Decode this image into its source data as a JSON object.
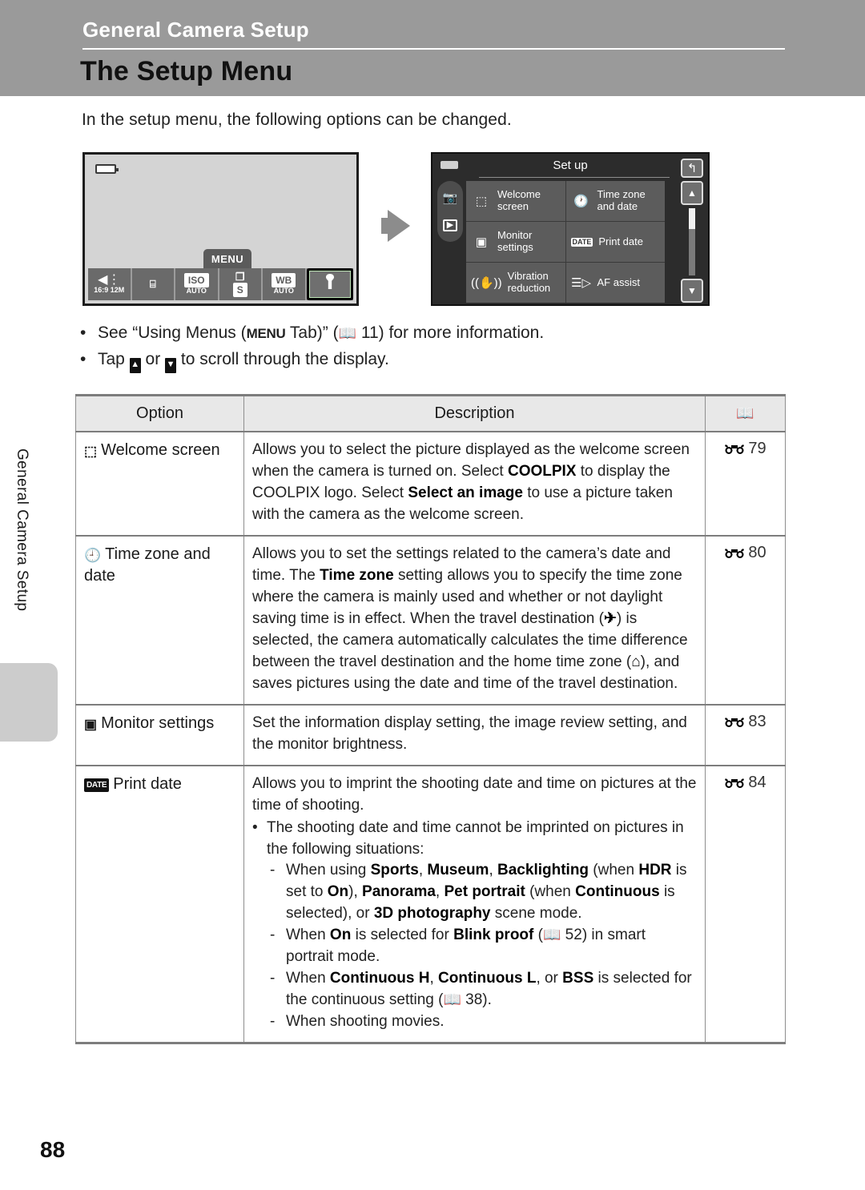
{
  "header": {
    "chapter": "General Camera Setup",
    "title": "The Setup Menu"
  },
  "intro": "In the setup menu, the following options can be changed.",
  "figure": {
    "camera_screen": {
      "menu_tab_label": "MENU",
      "battery_icon": "battery-icon",
      "menu_bar": [
        {
          "icon": "flash-icon",
          "top": "❮∷",
          "bottom": "16:9 12M",
          "selected": false
        },
        {
          "icon": "touch-shutter-icon",
          "top": "☐",
          "bottom": "",
          "selected": false
        },
        {
          "icon": "iso-icon",
          "top": "ISO",
          "bottom": "AUTO",
          "selected": false
        },
        {
          "icon": "continuous-icon",
          "top": "❐",
          "bottom": "S",
          "selected": false
        },
        {
          "icon": "white-balance-icon",
          "top": "WB",
          "bottom": "AUTO",
          "selected": false
        },
        {
          "icon": "wrench-setup-icon",
          "top": "⑀",
          "bottom": "",
          "selected": true
        }
      ]
    },
    "arrow_icon": "right-arrow-icon",
    "setup_screen": {
      "title": "Set up",
      "back_icon": "back-arrow-icon",
      "side_tabs": [
        "shooting-mode-icon",
        "playback-mode-icon"
      ],
      "scroll_up_icon": "triangle-up-icon",
      "scroll_down_icon": "triangle-down-icon",
      "items": [
        {
          "icon": "welcome-screen-icon",
          "label": "Welcome\nscreen"
        },
        {
          "icon": "clock-icon",
          "label": "Time zone\nand date"
        },
        {
          "icon": "monitor-icon",
          "label": "Monitor\nsettings"
        },
        {
          "icon": "date-badge-icon",
          "label": "Print date",
          "badge": "DATE"
        },
        {
          "icon": "vibration-reduction-icon",
          "label": "Vibration\nreduction"
        },
        {
          "icon": "af-assist-icon",
          "label": "AF assist"
        }
      ]
    }
  },
  "bullets": [
    {
      "parts": [
        {
          "t": "See “Using Menus (",
          "style": "normal"
        },
        {
          "t": "MENU",
          "style": "menu"
        },
        {
          "t": " Tab)” (",
          "style": "normal"
        },
        {
          "t": "📖",
          "style": "book"
        },
        {
          "t": " 11) for more information.",
          "style": "normal"
        }
      ]
    },
    {
      "parts": [
        {
          "t": "Tap ",
          "style": "normal"
        },
        {
          "t": "▲",
          "style": "arrowbox"
        },
        {
          "t": " or ",
          "style": "normal"
        },
        {
          "t": "▼",
          "style": "arrowbox"
        },
        {
          "t": " to scroll through the display.",
          "style": "normal"
        }
      ]
    }
  ],
  "table": {
    "headers": {
      "option": "Option",
      "description": "Description",
      "reference_icon": "book-icon"
    },
    "rows": [
      {
        "option_icon": "welcome-screen-icon",
        "option_glyph": "⬚",
        "option_label": "Welcome screen",
        "description_html": "Allows you to select the picture displayed as the welcome screen when the camera is turned on. Select <b>COOLPIX</b> to display the COOLPIX logo. Select <b>Select an image</b> to use a picture taken with the camera as the welcome screen.",
        "reference": "79"
      },
      {
        "option_icon": "clock-icon",
        "option_glyph": "⥁",
        "option_label": "Time zone and date",
        "description_html": "Allows you to set the settings related to the camera’s date and time. The <b>Time zone</b> setting allows you to specify the time zone where the camera is mainly used and whether or not daylight saving time is in effect. When the travel destination (✈) is selected, the camera automatically calculates the time difference between the travel destination and the home time zone (⌂), and saves pictures using the date and time of the travel destination.",
        "reference": "80"
      },
      {
        "option_icon": "monitor-icon",
        "option_glyph": "▣",
        "option_label": "Monitor settings",
        "description_html": "Set the information display setting, the image review setting, and the monitor brightness.",
        "reference": "83"
      },
      {
        "option_icon": "date-badge-icon",
        "option_badge": "DATE",
        "option_label": "Print date",
        "description_intro_html": "Allows you to imprint the shooting date and time on pictures at the time of shooting.",
        "description_bullets": [
          {
            "marker": "•",
            "text_html": "The shooting date and time cannot be imprinted on pictures in the following situations:",
            "subitems": [
              {
                "marker": "-",
                "text_html": "When using <b>Sports</b>, <b>Museum</b>, <b>Backlighting</b> (when <b>HDR</b> is set to <b>On</b>), <b>Panorama</b>, <b>Pet portrait</b> (when <b>Continuous</b> is selected), or <b>3D photography</b> scene mode."
              },
              {
                "marker": "-",
                "text_html": "When <b>On</b> is selected for <b>Blink proof</b> (📖 52) in smart portrait mode."
              },
              {
                "marker": "-",
                "text_html": "When <b>Continuous H</b>, <b>Continuous L</b>, or <b>BSS</b> is selected for the continuous setting (📖 38)."
              },
              {
                "marker": "-",
                "text_html": "When shooting movies."
              }
            ]
          }
        ],
        "reference": "84"
      }
    ]
  },
  "side_tab_text": "General Camera Setup",
  "page_number": "88",
  "colors": {
    "header_band": "#9a9a9a",
    "table_header_bg": "#e8e8e8",
    "rule": "#7d7d7d",
    "side_tab": "#cccccc",
    "screen_dark": "#2c2c2c",
    "screen_cell": "#5c5c5c"
  }
}
